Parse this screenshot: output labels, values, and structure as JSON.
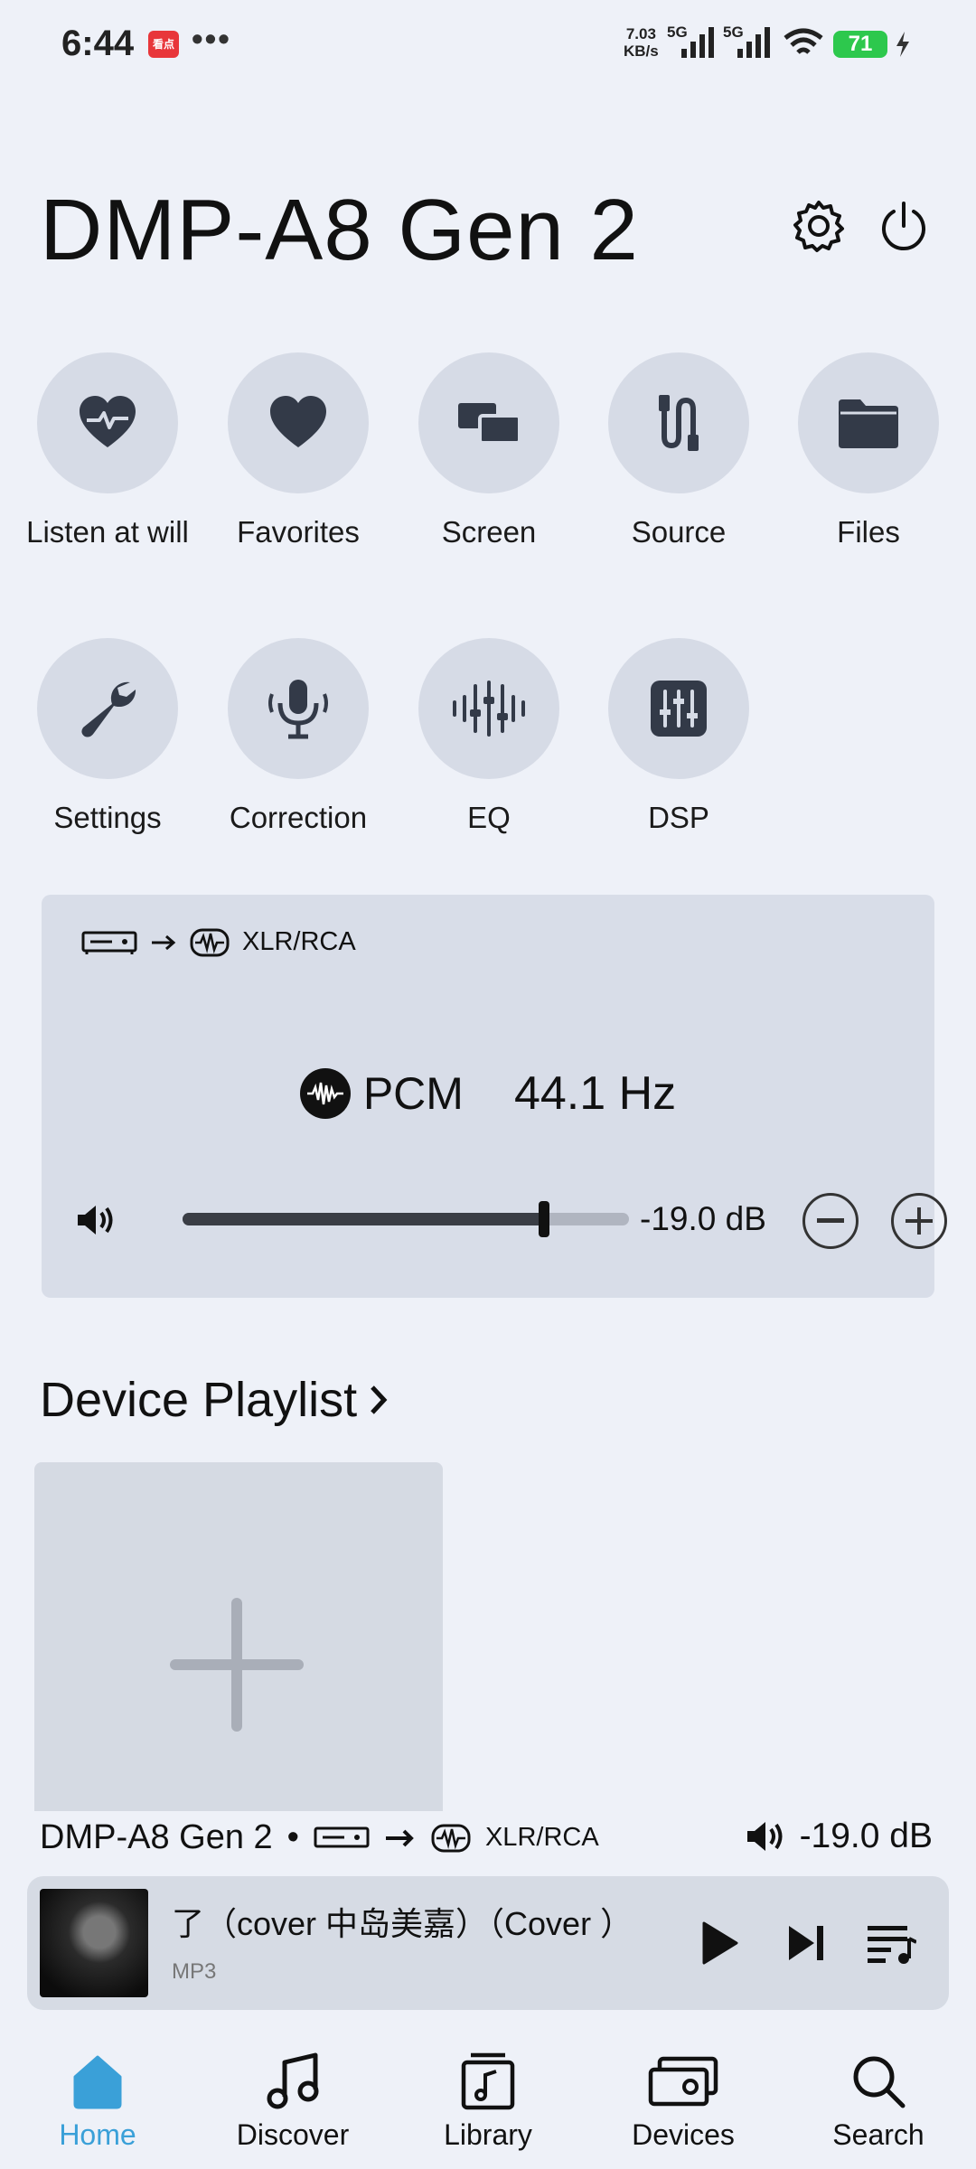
{
  "status_bar": {
    "time": "6:44",
    "app_badge": "看点",
    "more": "•••",
    "speed_value": "7.03",
    "speed_unit": "KB/s",
    "net1": "5G",
    "net2": "5G",
    "battery": "71"
  },
  "header": {
    "title": "DMP-A8 Gen 2"
  },
  "shortcuts": [
    {
      "label": "Listen at will",
      "icon": "heart-pulse-icon"
    },
    {
      "label": "Favorites",
      "icon": "heart-icon"
    },
    {
      "label": "Screen",
      "icon": "screens-icon"
    },
    {
      "label": "Source",
      "icon": "cable-icon"
    },
    {
      "label": "Files",
      "icon": "folder-icon"
    },
    {
      "label": "Settings",
      "icon": "wrench-icon"
    },
    {
      "label": "Correction",
      "icon": "microphone-icon"
    },
    {
      "label": "EQ",
      "icon": "eq-sliders-icon"
    },
    {
      "label": "DSP",
      "icon": "dsp-icon"
    }
  ],
  "status_card": {
    "route_output": "XLR/RCA",
    "format": "PCM",
    "sample_rate": "44.1 Hz",
    "volume_db": "-19.0 dB",
    "volume_level": 0.81
  },
  "playlist": {
    "title": "Device Playlist"
  },
  "now_playing": {
    "device": "DMP-A8 Gen 2",
    "separator": "•",
    "output": "XLR/RCA",
    "volume": "-19.0 dB",
    "song_title": "了（cover 中岛美嘉）（Cover ）",
    "format": "MP3"
  },
  "nav": [
    {
      "label": "Home",
      "icon": "home-icon",
      "active": true
    },
    {
      "label": "Discover",
      "icon": "music-note-icon",
      "active": false
    },
    {
      "label": "Library",
      "icon": "library-icon",
      "active": false
    },
    {
      "label": "Devices",
      "icon": "devices-icon",
      "active": false
    },
    {
      "label": "Search",
      "icon": "search-icon",
      "active": false
    }
  ],
  "colors": {
    "background": "#eef1f8",
    "circle": "#d6dbe6",
    "card": "#d8dde8",
    "icon": "#333a48",
    "accent": "#3aa0d8",
    "battery": "#2dc84d"
  }
}
